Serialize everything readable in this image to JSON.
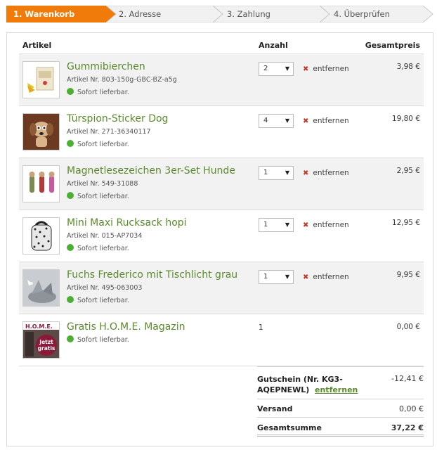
{
  "steps": [
    {
      "label": "1. Warenkorb",
      "active": true
    },
    {
      "label": "2. Adresse",
      "active": false
    },
    {
      "label": "3. Zahlung",
      "active": false
    },
    {
      "label": "4. Überprüfen",
      "active": false
    }
  ],
  "table": {
    "col_article": "Artikel",
    "col_qty": "Anzahl",
    "col_total": "Gesamtpreis"
  },
  "items": [
    {
      "name": "Gummibierchen",
      "article_no": "Artikel Nr. 803-150g-GBC-BZ-a5g",
      "availability": "Sofort lieferbar.",
      "qty": "2",
      "remove_label": "entfernen",
      "price": "3,98 €",
      "thumb_icon": "gummy-bears-image"
    },
    {
      "name": "Türspion-Sticker Dog",
      "article_no": "Artikel Nr. 271-36340117",
      "availability": "Sofort lieferbar.",
      "qty": "4",
      "remove_label": "entfernen",
      "price": "19,80 €",
      "thumb_icon": "dog-sticker-image"
    },
    {
      "name": "Magnetlesezeichen 3er-Set Hunde",
      "article_no": "Artikel Nr. 549-31088",
      "availability": "Sofort lieferbar.",
      "qty": "1",
      "remove_label": "entfernen",
      "price": "2,95 €",
      "thumb_icon": "bookmark-set-image"
    },
    {
      "name": "Mini Maxi Rucksack hopi",
      "article_no": "Artikel Nr. 015-AP7034",
      "availability": "Sofort lieferbar.",
      "qty": "1",
      "remove_label": "entfernen",
      "price": "12,95 €",
      "thumb_icon": "backpack-image"
    },
    {
      "name": "Fuchs Frederico mit Tischlicht grau",
      "article_no": "Artikel Nr. 495-063003",
      "availability": "Sofort lieferbar.",
      "qty": "1",
      "remove_label": "entfernen",
      "price": "9,95 €",
      "thumb_icon": "fox-lamp-image"
    },
    {
      "name": "Gratis H.O.M.E. Magazin",
      "availability": "Sofort lieferbar.",
      "qty": "1",
      "price": "0,00 €",
      "thumb_icon": "magazine-image",
      "thumb_text_title": "H.O.M.E.",
      "thumb_text_badge": "Jetzt gratis"
    }
  ],
  "totals": {
    "voucher_label": "Gutschein (Nr. KG3-AQEPNEWL)",
    "voucher_line1": "Gutschein (Nr. KG3-",
    "voucher_line2": "AQEPNEWL)",
    "voucher_remove": "entfernen",
    "voucher_value": "-12,41 €",
    "shipping_label": "Versand",
    "shipping_value": "0,00 €",
    "sum_label": "Gesamtsumme",
    "sum_value": "37,22 €"
  },
  "colors": {
    "accent_orange": "#f07b0a",
    "product_green": "#5a8a2b",
    "available_green": "#4caf34",
    "remove_red": "#c0392b"
  }
}
